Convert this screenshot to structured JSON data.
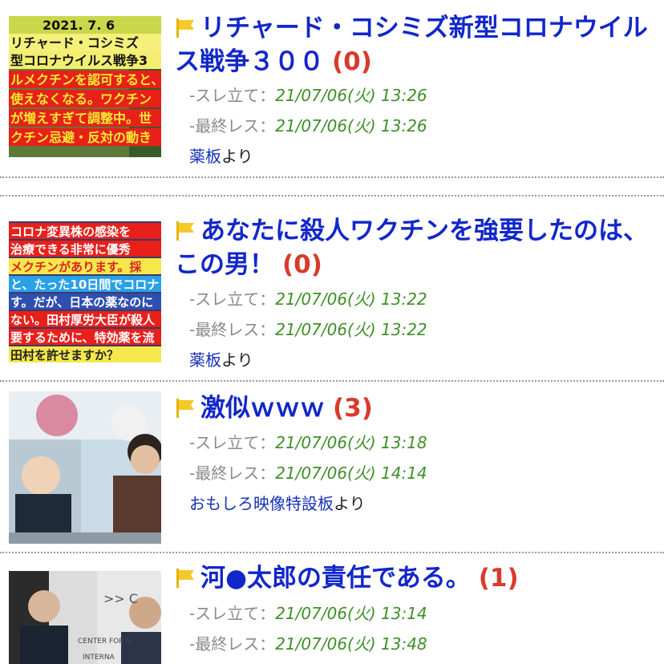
{
  "threads": [
    {
      "title": "リチャード・コシミズ新型コロナウイルス戦争３００",
      "count": "(0)",
      "created_label": "-スレ立て：",
      "created": "21/07/06(火) 13:26",
      "last_label": "-最終レス：",
      "last": "21/07/06(火) 13:26",
      "board": "薬板",
      "from": "より",
      "thumb_lines": [
        "2021. 7. 6",
        "リチャード・コシミズ",
        "型コロナウイルス戦争3",
        "ルメクチンを認可すると、",
        "使えなくなる。ワクチン",
        "が増えすぎて調整中。世",
        "クチン忌避・反対の動き"
      ]
    },
    {
      "title": "あなたに殺人ワクチンを強要したのは、この男！",
      "count": "(0)",
      "created_label": "-スレ立て：",
      "created": "21/07/06(火) 13:22",
      "last_label": "-最終レス：",
      "last": "21/07/06(火) 13:22",
      "board": "薬板",
      "from": "より",
      "thumb_lines": [
        "コロナ変異株の感染を",
        "治療できる非常に優秀",
        "メクチンがあります。採",
        "と、たった10日間でコロナ",
        "す。だが、日本の薬なのに",
        "ない。田村厚労大臣が殺人",
        "要するために、特効薬を流",
        "田村を許せますか？"
      ]
    },
    {
      "title": "激似ｗｗｗ",
      "count": "(3)",
      "created_label": "-スレ立て：",
      "created": "21/07/06(火) 13:18",
      "last_label": "-最終レス：",
      "last": "21/07/06(火) 14:14",
      "board": "おもしろ映像特設板",
      "from": "より"
    },
    {
      "title": "河●太郎の責任である。",
      "count": "(1)",
      "created_label": "-スレ立て：",
      "created": "21/07/06(火) 13:14",
      "last_label": "-最終レス：",
      "last": "21/07/06(火) 13:48",
      "thumb_lines": [
        ">> C",
        "CENTER FOR S",
        "INTERNA"
      ]
    }
  ]
}
